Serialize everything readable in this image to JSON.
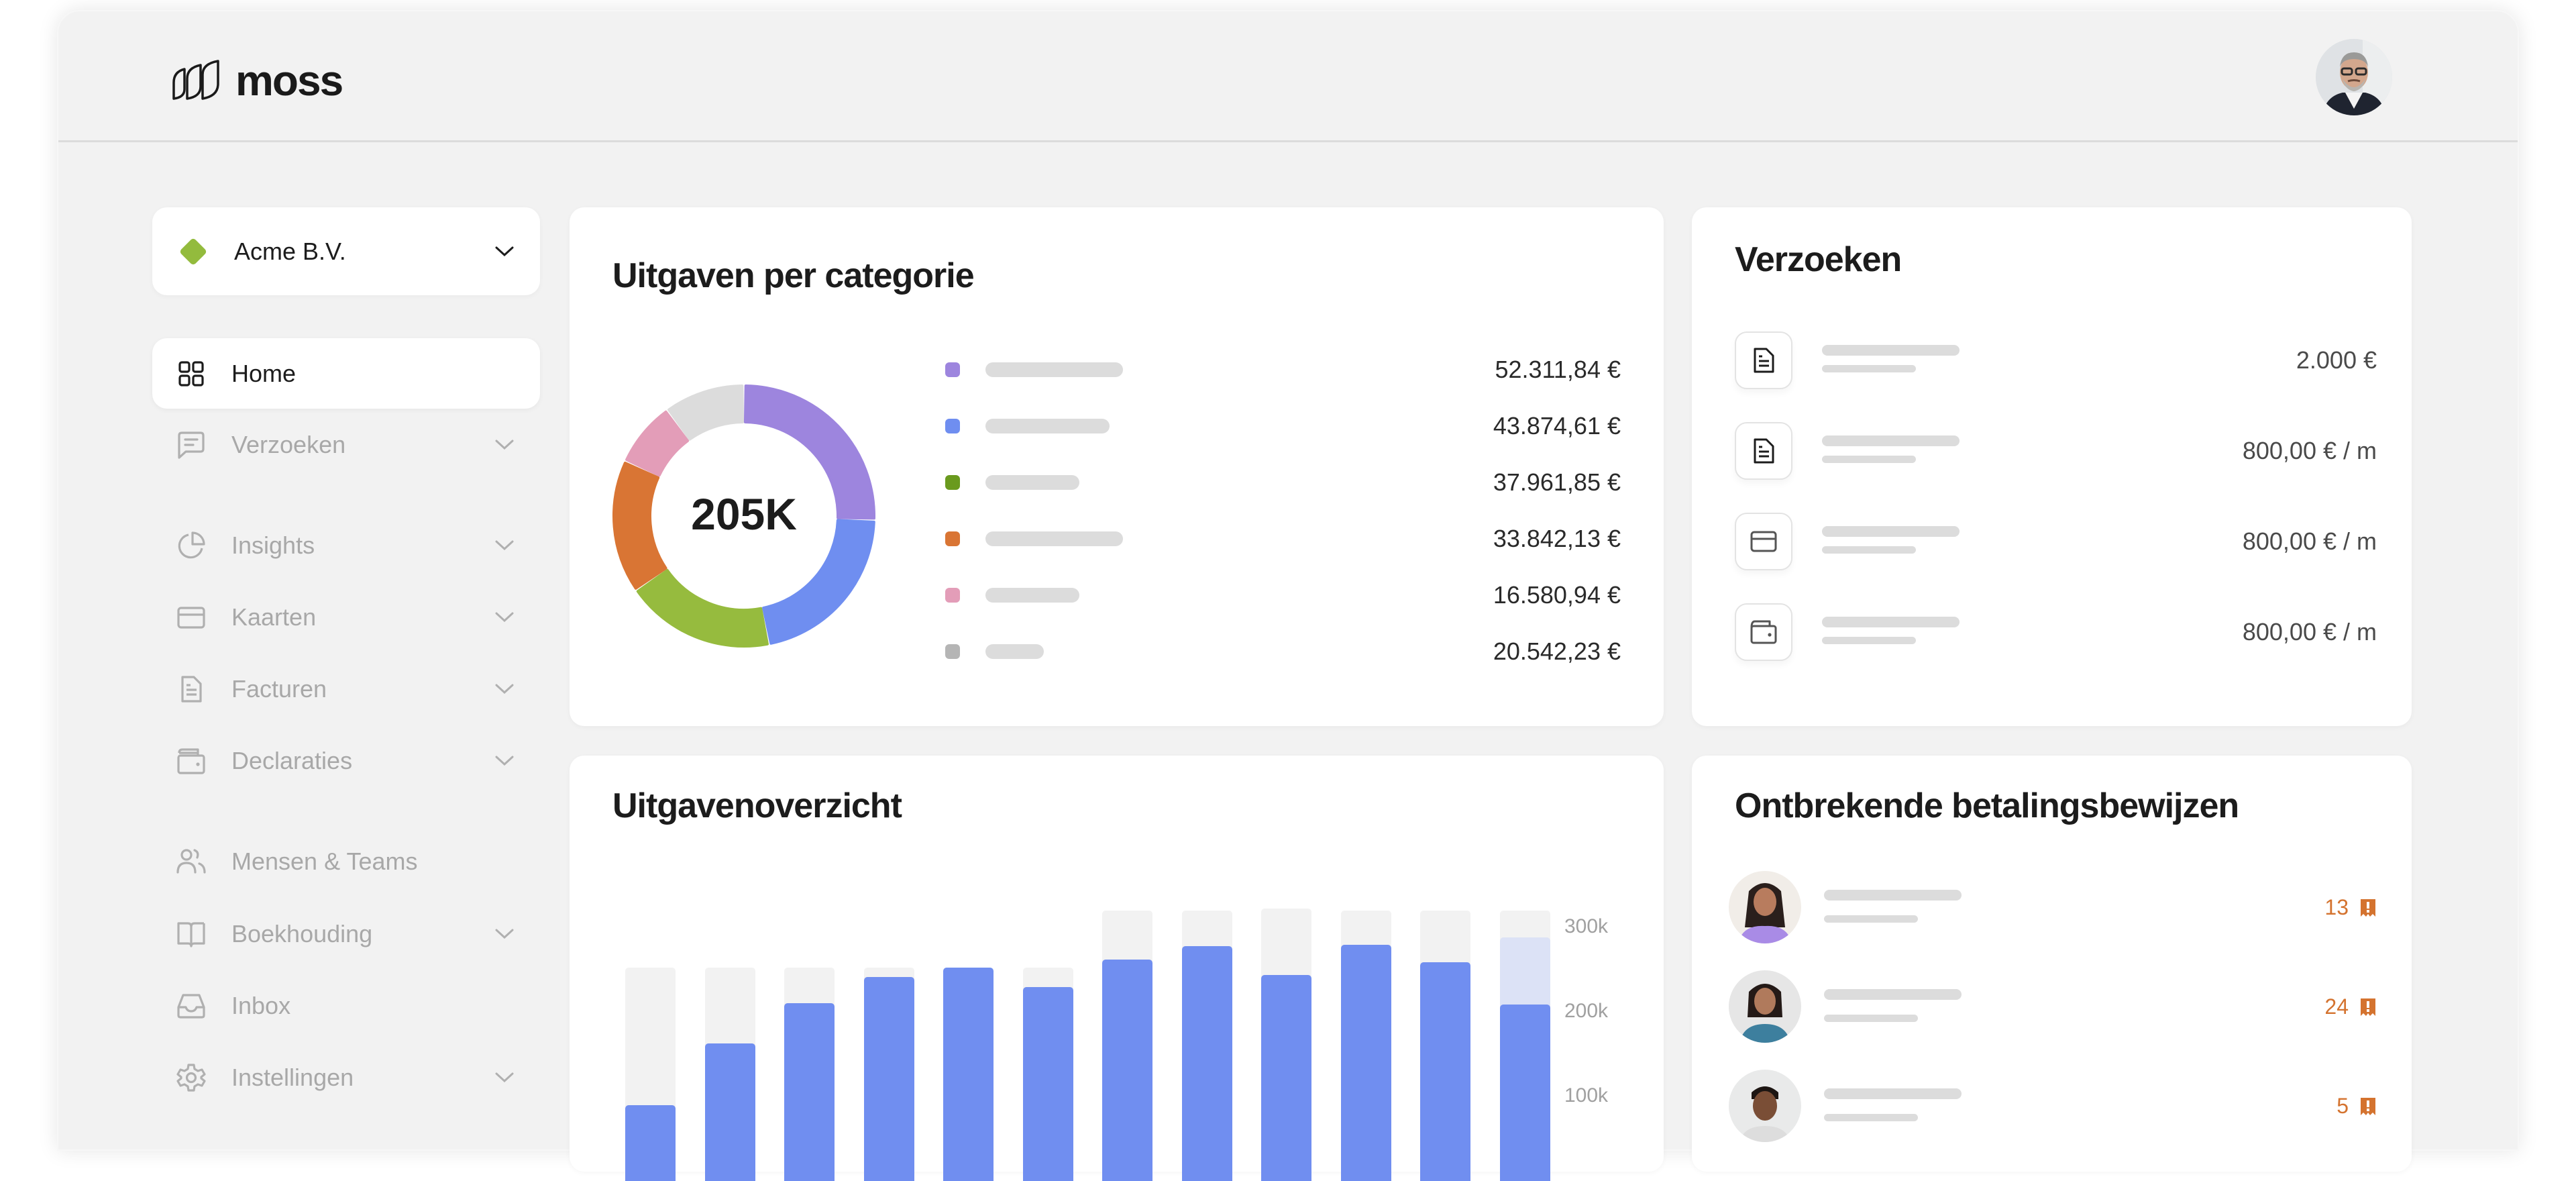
{
  "header": {
    "logo_text": "moss",
    "user_avatar": "user-avatar-photo"
  },
  "sidebar": {
    "company": {
      "name": "Acme B.V.",
      "color": "#93bb3d",
      "icon": "chevron-down-icon"
    },
    "items": [
      {
        "label": "Home",
        "icon": "grid-icon",
        "active": true,
        "expandable": false
      },
      {
        "label": "Verzoeken",
        "icon": "message-square-icon",
        "active": false,
        "expandable": true
      },
      {
        "label": "Insights",
        "icon": "pie-chart-icon",
        "active": false,
        "expandable": true
      },
      {
        "label": "Kaarten",
        "icon": "credit-card-icon",
        "active": false,
        "expandable": true
      },
      {
        "label": "Facturen",
        "icon": "document-icon",
        "active": false,
        "expandable": true
      },
      {
        "label": "Declaraties",
        "icon": "wallet-icon",
        "active": false,
        "expandable": true
      },
      {
        "label": "Mensen & Teams",
        "icon": "users-icon",
        "active": false,
        "expandable": false
      },
      {
        "label": "Boekhouding",
        "icon": "book-icon",
        "active": false,
        "expandable": true
      },
      {
        "label": "Inbox",
        "icon": "inbox-icon",
        "active": false,
        "expandable": false
      },
      {
        "label": "Instellingen",
        "icon": "gear-icon",
        "active": false,
        "expandable": true
      }
    ]
  },
  "categories_card": {
    "title": "Uitgaven per categorie",
    "total_label": "205K"
  },
  "requests_card": {
    "title": "Verzoeken",
    "items": [
      {
        "icon": "document-icon",
        "value": "2.000 €"
      },
      {
        "icon": "document-icon",
        "value": "800,00 € / m"
      },
      {
        "icon": "credit-card-icon",
        "value": "800,00 € / m"
      },
      {
        "icon": "wallet-icon",
        "value": "800,00 € / m"
      }
    ]
  },
  "overview_card": {
    "title": "Uitgavenoverzicht"
  },
  "missing_card": {
    "title": "Ontbrekende betalingsbewijzen",
    "accent": "#d4732f",
    "items": [
      {
        "avatar": "person-avatar-1",
        "count": "13",
        "icon": "receipt-alert-icon"
      },
      {
        "avatar": "person-avatar-2",
        "count": "24",
        "icon": "receipt-alert-icon"
      },
      {
        "avatar": "person-avatar-3",
        "count": "5",
        "icon": "receipt-alert-icon"
      }
    ]
  },
  "chart_data": [
    {
      "type": "pie",
      "title": "Uitgaven per categorie",
      "center_label": "205K",
      "categories": [
        "",
        "",
        "",
        "",
        "",
        ""
      ],
      "values": [
        52311.84,
        43874.61,
        37961.85,
        33842.13,
        16580.94,
        20542.23
      ],
      "value_labels": [
        "52.311,84 €",
        "43.874,61 €",
        "37.961,85 €",
        "33.842,13 €",
        "16.580,94 €",
        "20.542,23 €"
      ],
      "colors": [
        "#9d85de",
        "#6f8ef0",
        "#96bb3e",
        "#d97534",
        "#e39db8",
        "#dcdcdc"
      ],
      "legend_dot_colors": [
        "#9d85de",
        "#6f8ef0",
        "#6a9a1e",
        "#d97534",
        "#e39db8",
        "#b5b5b5"
      ],
      "legend": "right"
    },
    {
      "type": "bar",
      "title": "Uitgavenoverzicht",
      "xlabel": "",
      "ylabel": "",
      "yticks": [
        "100k",
        "200k",
        "300k"
      ],
      "ytick_values": [
        100000,
        200000,
        300000
      ],
      "ylim": [
        0,
        300000
      ],
      "series": [
        {
          "name": "spent",
          "color": "#708ef0",
          "values": [
            90000,
            163000,
            210000,
            241000,
            252000,
            229000,
            262000,
            278000,
            244000,
            279000,
            259000,
            209000
          ]
        },
        {
          "name": "projected",
          "color": "#dce2f6",
          "values": [
            null,
            null,
            null,
            null,
            null,
            null,
            null,
            null,
            null,
            null,
            null,
            288000
          ]
        },
        {
          "name": "budget",
          "color": "#f2f2f2",
          "values": [
            252000,
            252000,
            252000,
            252000,
            252000,
            252000,
            320000,
            320000,
            322000,
            320000,
            320000,
            320000
          ]
        }
      ],
      "legend": "none",
      "grid": false
    }
  ]
}
